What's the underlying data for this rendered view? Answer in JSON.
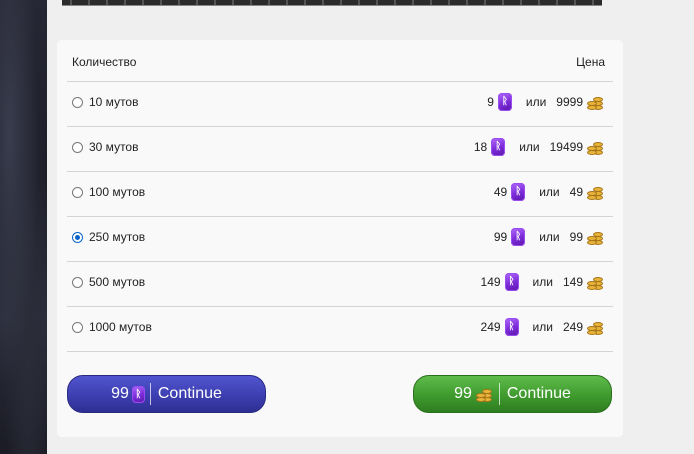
{
  "header": {
    "quantity_label": "Количество",
    "price_label": "Цена"
  },
  "rows": [
    {
      "label": "10 мутов",
      "rune_price": "9",
      "or_label": "или",
      "gold_price": "9999",
      "selected": false
    },
    {
      "label": "30 мутов",
      "rune_price": "18",
      "or_label": "или",
      "gold_price": "19499",
      "selected": false
    },
    {
      "label": "100 мутов",
      "rune_price": "49",
      "or_label": "или",
      "gold_price": "49",
      "selected": false
    },
    {
      "label": "250 мутов",
      "rune_price": "99",
      "or_label": "или",
      "gold_price": "99",
      "selected": true
    },
    {
      "label": "500 мутов",
      "rune_price": "149",
      "or_label": "или",
      "gold_price": "149",
      "selected": false
    },
    {
      "label": "1000 мутов",
      "rune_price": "249",
      "or_label": "или",
      "gold_price": "249",
      "selected": false
    }
  ],
  "buttons": {
    "rune": {
      "price": "99",
      "label": "Continue",
      "color": "#3d3fb0"
    },
    "gold": {
      "price": "99",
      "label": "Continue",
      "color": "#3f9a2e"
    }
  },
  "icons": {
    "rune": "rune-icon",
    "gold": "gold-coins-icon",
    "rune_glyph": "ᚱ"
  }
}
